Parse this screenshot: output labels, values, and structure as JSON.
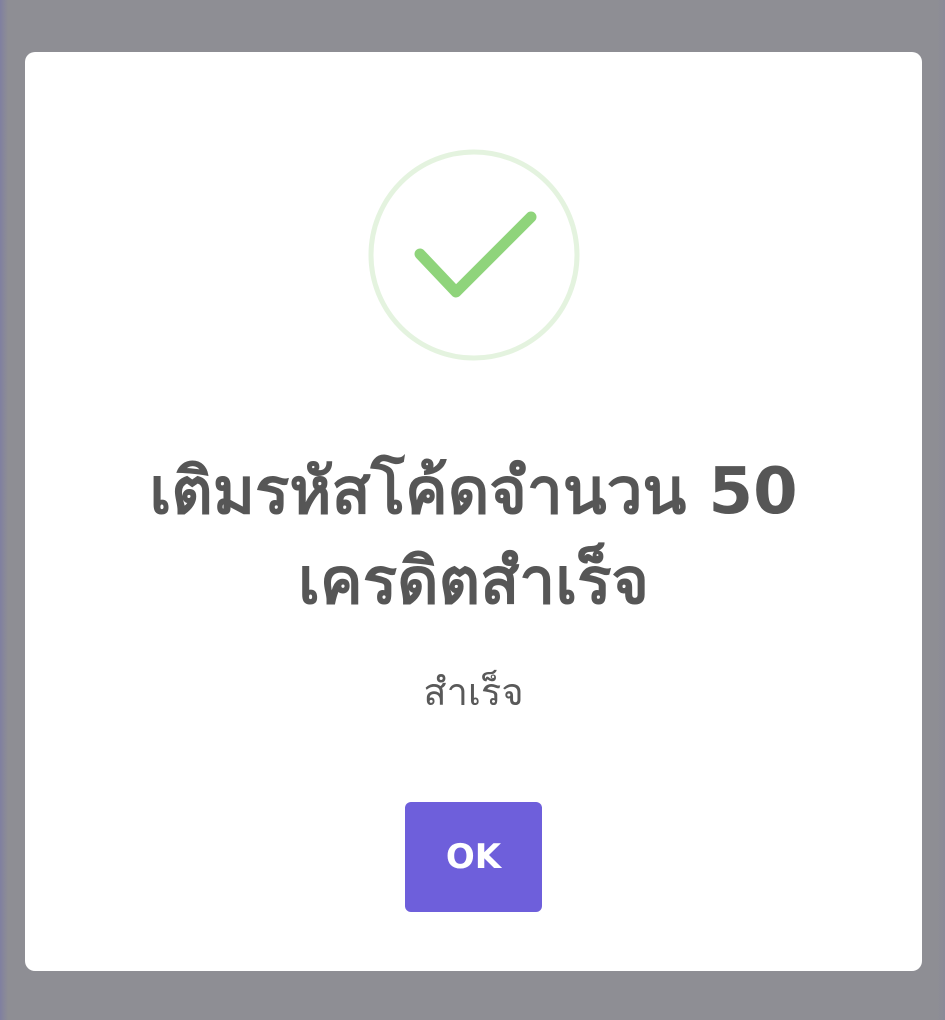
{
  "dialog": {
    "icon": "success-check-icon",
    "title": "เติมรหัสโค้ดจำนวน 50 เครดิตสำเร็จ",
    "message": "สำเร็จ",
    "ok_label": "OK"
  },
  "colors": {
    "overlay": "#8f8f94",
    "check": "#8fd47b",
    "check_ring": "#e4f3df",
    "title_text": "#565656",
    "button": "#6e5fdb",
    "button_text": "#ffffff"
  }
}
